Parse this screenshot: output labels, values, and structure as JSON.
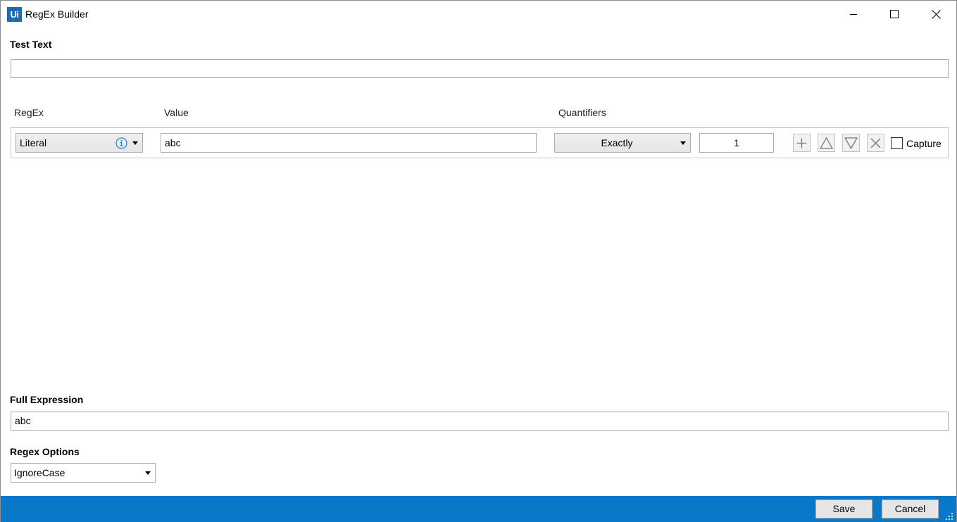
{
  "window": {
    "app_logo": "Ui",
    "title": "RegEx Builder"
  },
  "test_text": {
    "label": "Test Text",
    "value": ""
  },
  "columns": {
    "regex": "RegEx",
    "value": "Value",
    "quantifiers": "Quantifiers"
  },
  "row": {
    "regex_type": "Literal",
    "value": "abc",
    "quantifier": "Exactly",
    "count": "1",
    "capture_label": "Capture",
    "capture_checked": false
  },
  "full_expression": {
    "label": "Full Expression",
    "value": "abc"
  },
  "regex_options": {
    "label": "Regex Options",
    "selected": "IgnoreCase"
  },
  "footer": {
    "save_label": "Save",
    "cancel_label": "Cancel",
    "bar_color": "#0a78c8"
  },
  "icons": {
    "info": "info-icon",
    "add": "plus-icon",
    "move_up": "triangle-up-icon",
    "move_down": "triangle-down-icon",
    "delete": "x-icon"
  }
}
